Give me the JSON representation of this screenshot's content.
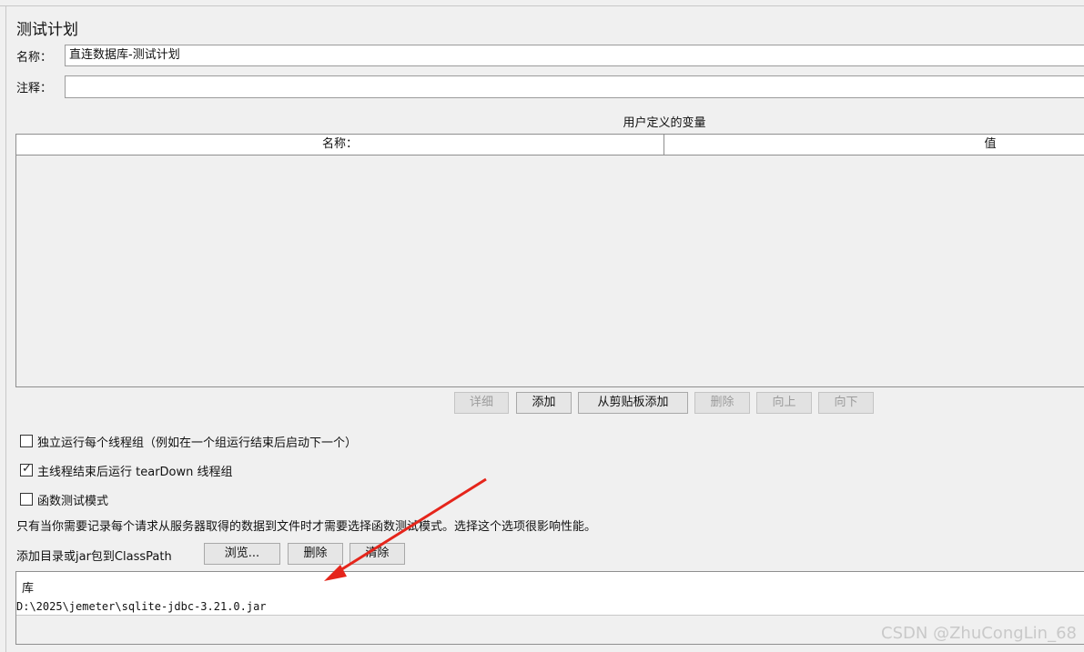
{
  "panel": {
    "title": "测试计划",
    "name_label": "名称：",
    "name_value": "直连数据库-测试计划",
    "comment_label": "注释：",
    "comment_value": ""
  },
  "user_vars": {
    "title": "用户定义的变量",
    "columns": [
      "名称：",
      "值"
    ],
    "rows": [],
    "buttons": {
      "detail": "详细",
      "add": "添加",
      "add_clipboard": "从剪贴板添加",
      "delete": "删除",
      "up": "向上",
      "down": "向下"
    }
  },
  "options": {
    "run_groups_consecutively": {
      "label": "独立运行每个线程组（例如在一个组运行结束后启动下一个）",
      "checked": false
    },
    "teardown_after_shutdown": {
      "label": "主线程结束后运行 tearDown 线程组",
      "checked": true
    },
    "functional_mode": {
      "label": "函数测试模式",
      "checked": false
    },
    "functional_note": "只有当你需要记录每个请求从服务器取得的数据到文件时才需要选择函数测试模式。选择这个选项很影响性能。"
  },
  "classpath": {
    "label": "添加目录或jar包到ClassPath",
    "browse": "浏览...",
    "delete": "删除",
    "clear": "清除",
    "column": "库",
    "entries": [
      "D:\\2025\\jemeter\\sqlite-jdbc-3.21.0.jar"
    ]
  },
  "annotation": {
    "arrow_color": "#e5251b"
  },
  "watermark": "CSDN @ZhuCongLin_68"
}
